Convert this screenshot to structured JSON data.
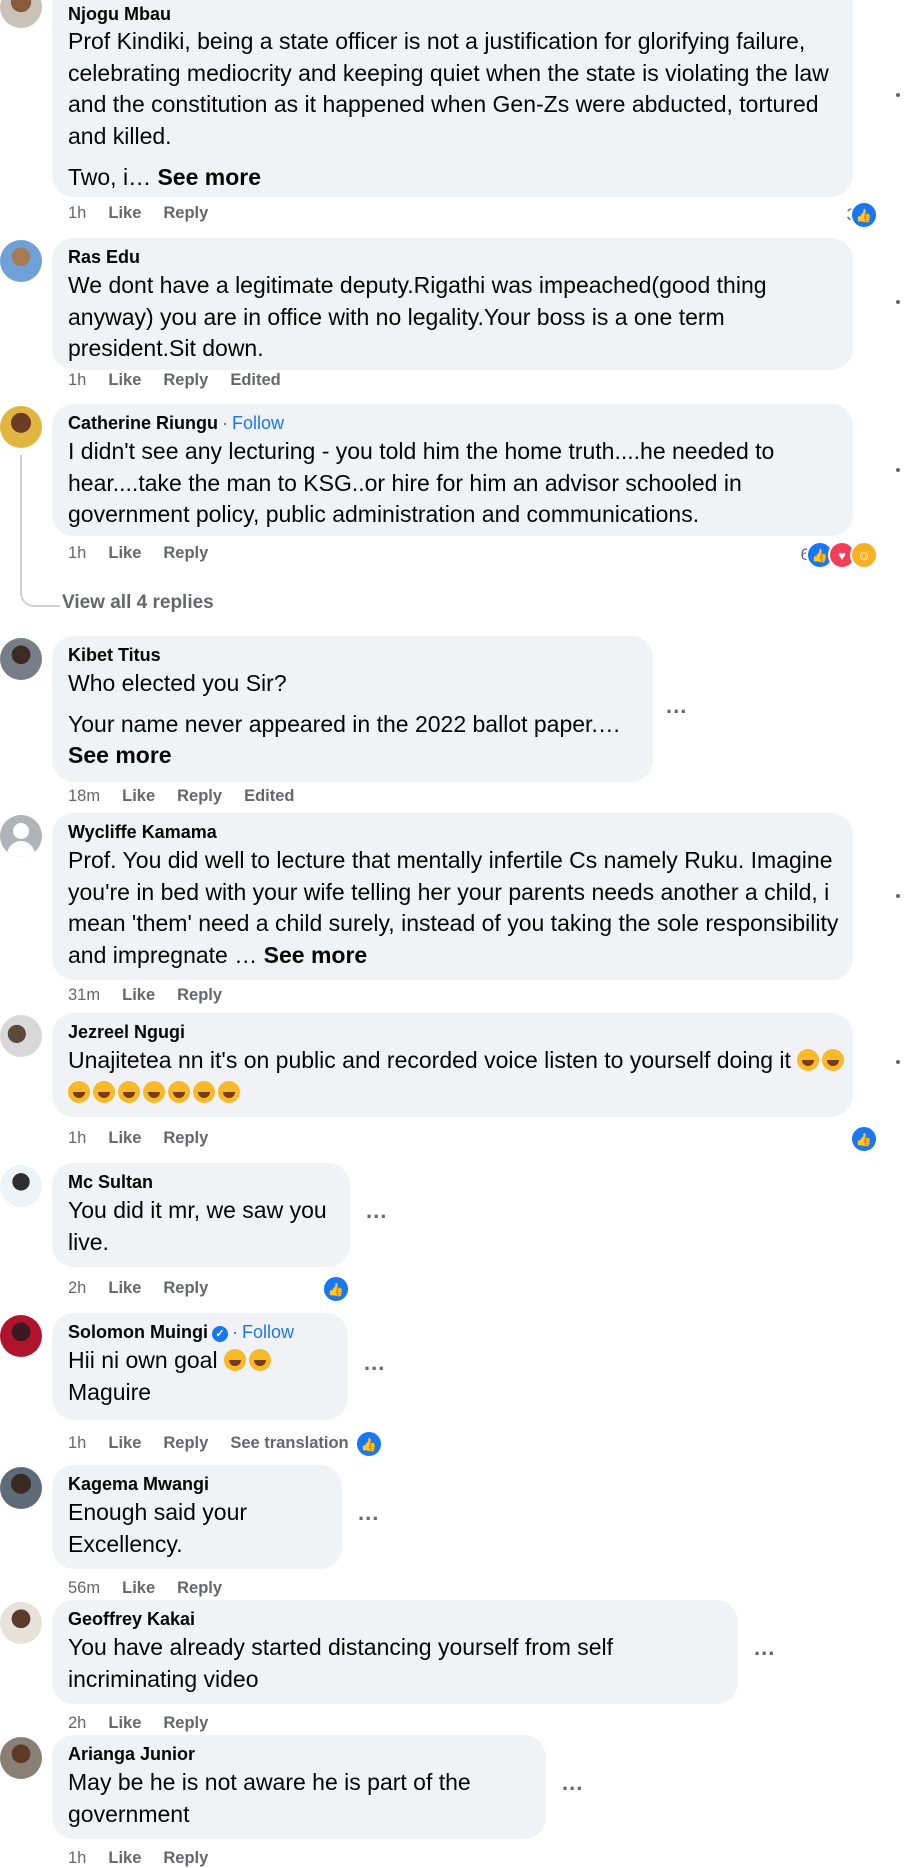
{
  "actions": {
    "like": "Like",
    "reply": "Reply",
    "follow": "Follow",
    "see_more": "See more",
    "view_replies": "View all 4 replies",
    "more_icon": "...",
    "separator": "·"
  },
  "comments": [
    {
      "name": "Njogu Mbau",
      "time": "1h",
      "extra": "",
      "text": "Prof Kindiki, being a state officer is not a justification for glorifying failure, celebrating mediocrity and keeping quiet when the state is violating the law and the constitution as it happened when Gen-Zs were abducted, tortured and killed.",
      "text2": "Two, i… ",
      "reaction_count": "3",
      "reactions": [
        "like-icon"
      ]
    },
    {
      "name": "Ras Edu",
      "time": "1h",
      "extra": "Edited",
      "text": "We dont have a legitimate deputy.Rigathi was impeached(good thing anyway) you are in office with no legality.Your boss is a one term president.Sit down."
    },
    {
      "name": "Catherine Riungu",
      "time": "1h",
      "extra": "",
      "text": "I didn't see any lecturing - you told him the home truth....he needed to hear....take the man to KSG..or hire for him an advisor schooled in government policy, public administration and communications.",
      "reaction_count": "6",
      "reactions": [
        "like-icon",
        "love-icon",
        "haha-icon"
      ]
    },
    {
      "name": "Kibet Titus",
      "time": "18m",
      "extra": "Edited",
      "text": "Who elected you Sir?",
      "text2": "Your name never appeared in the 2022 ballot paper.…"
    },
    {
      "name": "Wycliffe Kamama",
      "time": "31m",
      "extra": "",
      "text": "Prof. You did well to lecture that mentally infertile Cs namely Ruku. Imagine you're in bed with your wife telling her your parents needs another a child, i mean 'them' need a child surely, instead of you taking the sole responsibility and impregnate … "
    },
    {
      "name": "Jezreel Ngugi",
      "time": "1h",
      "extra": "",
      "text": "Unajitetea nn it's on public and recorded voice listen to yourself doing it",
      "reactions": [
        "like-icon"
      ]
    },
    {
      "name": "Mc Sultan",
      "time": "2h",
      "extra": "",
      "text": "You did it mr, we saw you live.",
      "reactions": [
        "like-icon"
      ]
    },
    {
      "name": "Solomon Muingi",
      "time": "1h",
      "extra": "See translation",
      "text": "Hii ni own goal",
      "text2": "Maguire",
      "reactions": [
        "like-icon"
      ]
    },
    {
      "name": "Kagema Mwangi",
      "time": "56m",
      "extra": "",
      "text": "Enough said your Excellency."
    },
    {
      "name": "Geoffrey Kakai",
      "time": "2h",
      "extra": "",
      "text": "You have already started distancing yourself from self incriminating video"
    },
    {
      "name": "Arianga Junior",
      "time": "1h",
      "extra": "",
      "text": "May be he is not aware he is part of the government"
    }
  ]
}
